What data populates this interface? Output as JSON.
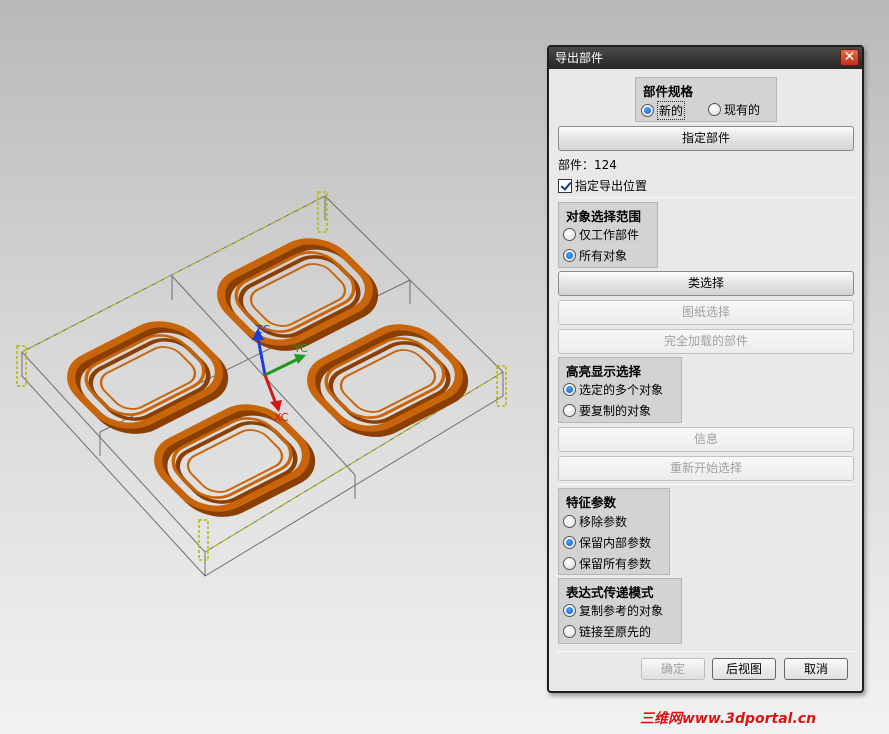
{
  "viewport": {
    "axis_labels": {
      "zc": "ZC",
      "yc": "YC",
      "xc": "XC"
    },
    "colors": {
      "part": "#c8650a",
      "part_dark": "#8a3f00",
      "wireframe": "#6e6e6e",
      "grip": "#b8b800",
      "axis_z": "#1a3de0",
      "axis_y": "#1e9a1e",
      "axis_x": "#d01818"
    }
  },
  "dialog": {
    "title": "导出部件",
    "close_icon": "close-icon",
    "part_spec": {
      "title": "部件规格",
      "options": [
        "新的",
        "现有的"
      ],
      "selected": "新的"
    },
    "specify_part_button": "指定部件",
    "part_label": "部件：124",
    "export_location_checkbox": {
      "label": "指定导出位置",
      "checked": true
    },
    "object_scope": {
      "title": "对象选择范围",
      "options": [
        "仅工作部件",
        "所有对象"
      ],
      "selected": "所有对象"
    },
    "class_select_button": "类选择",
    "drawing_select_button": "图纸选择",
    "fully_loaded_button": "完全加载的部件",
    "highlight": {
      "title": "高亮显示选择",
      "options": [
        "选定的多个对象",
        "要复制的对象"
      ],
      "selected": "选定的多个对象"
    },
    "info_button": "信息",
    "restart_button": "重新开始选择",
    "feature_params": {
      "title": "特征参数",
      "options": [
        "移除参数",
        "保留内部参数",
        "保留所有参数"
      ],
      "selected": "保留内部参数"
    },
    "expression_mode": {
      "title": "表达式传递模式",
      "options": [
        "复制参考的对象",
        "链接至原先的"
      ],
      "selected": "复制参考的对象"
    },
    "footer": {
      "ok": "确定",
      "back": "后视图",
      "cancel": "取消"
    }
  },
  "watermark": "三维网www.3dportal.cn"
}
